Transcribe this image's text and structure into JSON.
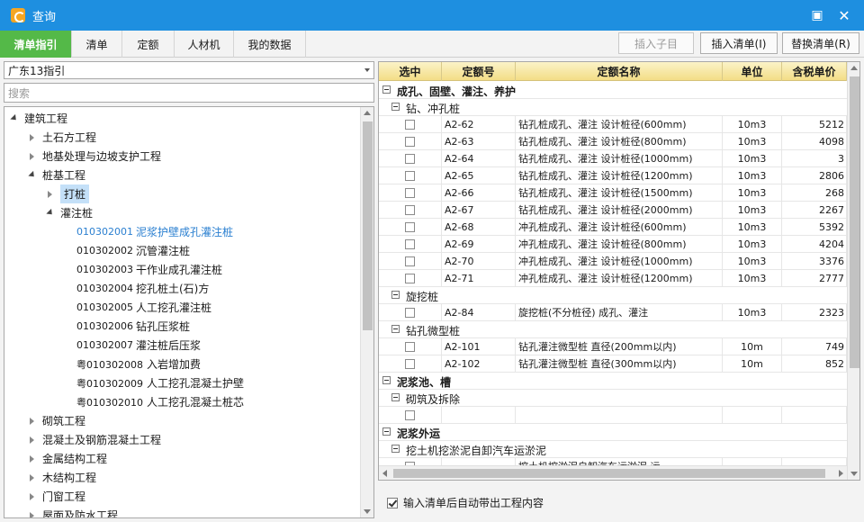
{
  "window": {
    "title": "查询"
  },
  "tabs": [
    {
      "label": "清单指引",
      "active": true
    },
    {
      "label": "清单"
    },
    {
      "label": "定额"
    },
    {
      "label": "人材机"
    },
    {
      "label": "我的数据"
    }
  ],
  "toolbar": {
    "insert_child": "插入子目",
    "insert_list": "插入清单(I)",
    "replace_list": "替换清单(R)"
  },
  "left": {
    "combo_value": "广东13指引",
    "search_placeholder": "搜索"
  },
  "tree": [
    {
      "label": "建筑工程",
      "level": 0,
      "state": "expanded"
    },
    {
      "label": "土石方工程",
      "level": 1,
      "state": "collapsed"
    },
    {
      "label": "地基处理与边坡支护工程",
      "level": 1,
      "state": "collapsed"
    },
    {
      "label": "桩基工程",
      "level": 1,
      "state": "expanded"
    },
    {
      "label": "打桩",
      "level": 2,
      "state": "collapsed",
      "selected": true
    },
    {
      "label": "灌注桩",
      "level": 2,
      "state": "expanded"
    },
    {
      "code": "010302001",
      "label": "泥浆护壁成孔灌注桩",
      "level": 3,
      "blue": true
    },
    {
      "code": "010302002",
      "label": "沉管灌注桩",
      "level": 3
    },
    {
      "code": "010302003",
      "label": "干作业成孔灌注桩",
      "level": 3
    },
    {
      "code": "010302004",
      "label": "挖孔桩土(石)方",
      "level": 3
    },
    {
      "code": "010302005",
      "label": "人工挖孔灌注桩",
      "level": 3
    },
    {
      "code": "010302006",
      "label": "钻孔压浆桩",
      "level": 3
    },
    {
      "code": "010302007",
      "label": "灌注桩后压浆",
      "level": 3
    },
    {
      "code": "粤010302008",
      "label": "入岩增加费",
      "level": 3,
      "wide": true
    },
    {
      "code": "粤010302009",
      "label": "人工挖孔混凝土护壁",
      "level": 3,
      "wide": true
    },
    {
      "code": "粤010302010",
      "label": "人工挖孔混凝土桩芯",
      "level": 3,
      "wide": true
    },
    {
      "label": "砌筑工程",
      "level": 1,
      "state": "collapsed"
    },
    {
      "label": "混凝土及钢筋混凝土工程",
      "level": 1,
      "state": "collapsed"
    },
    {
      "label": "金属结构工程",
      "level": 1,
      "state": "collapsed"
    },
    {
      "label": "木结构工程",
      "level": 1,
      "state": "collapsed"
    },
    {
      "label": "门窗工程",
      "level": 1,
      "state": "collapsed"
    },
    {
      "label": "屋面及防水工程",
      "level": 1,
      "state": "collapsed"
    }
  ],
  "grid": {
    "headers": [
      "选中",
      "定额号",
      "定额名称",
      "单位",
      "含税单价"
    ],
    "rows": [
      {
        "type": "g1",
        "label": "成孔、固壁、灌注、养护"
      },
      {
        "type": "g2",
        "label": "钻、冲孔桩"
      },
      {
        "type": "item",
        "code": "A2-62",
        "name": "钻孔桩成孔、灌注 设计桩径(600mm)",
        "unit": "10m3",
        "price": "5212"
      },
      {
        "type": "item",
        "code": "A2-63",
        "name": "钻孔桩成孔、灌注 设计桩径(800mm)",
        "unit": "10m3",
        "price": "4098"
      },
      {
        "type": "item",
        "code": "A2-64",
        "name": "钻孔桩成孔、灌注 设计桩径(1000mm)",
        "unit": "10m3",
        "price": "3"
      },
      {
        "type": "item",
        "code": "A2-65",
        "name": "钻孔桩成孔、灌注 设计桩径(1200mm)",
        "unit": "10m3",
        "price": "2806"
      },
      {
        "type": "item",
        "code": "A2-66",
        "name": "钻孔桩成孔、灌注 设计桩径(1500mm)",
        "unit": "10m3",
        "price": "268"
      },
      {
        "type": "item",
        "code": "A2-67",
        "name": "钻孔桩成孔、灌注 设计桩径(2000mm)",
        "unit": "10m3",
        "price": "2267"
      },
      {
        "type": "item",
        "code": "A2-68",
        "name": "冲孔桩成孔、灌注 设计桩径(600mm)",
        "unit": "10m3",
        "price": "5392"
      },
      {
        "type": "item",
        "code": "A2-69",
        "name": "冲孔桩成孔、灌注 设计桩径(800mm)",
        "unit": "10m3",
        "price": "4204"
      },
      {
        "type": "item",
        "code": "A2-70",
        "name": "冲孔桩成孔、灌注 设计桩径(1000mm)",
        "unit": "10m3",
        "price": "3376"
      },
      {
        "type": "item",
        "code": "A2-71",
        "name": "冲孔桩成孔、灌注 设计桩径(1200mm)",
        "unit": "10m3",
        "price": "2777"
      },
      {
        "type": "g2",
        "label": "旋挖桩"
      },
      {
        "type": "item",
        "code": "A2-84",
        "name": "旋挖桩(不分桩径) 成孔、灌注",
        "unit": "10m3",
        "price": "2323"
      },
      {
        "type": "g2",
        "label": "钻孔微型桩"
      },
      {
        "type": "item",
        "code": "A2-101",
        "name": "钻孔灌注微型桩 直径(200mm以内)",
        "unit": "10m",
        "price": "749"
      },
      {
        "type": "item",
        "code": "A2-102",
        "name": "钻孔灌注微型桩 直径(300mm以内)",
        "unit": "10m",
        "price": "852"
      },
      {
        "type": "g1",
        "label": "泥浆池、槽"
      },
      {
        "type": "g2",
        "label": "砌筑及拆除"
      },
      {
        "type": "item",
        "code": "",
        "name": "",
        "unit": "",
        "price": ""
      },
      {
        "type": "g1",
        "label": "泥浆外运"
      },
      {
        "type": "g2",
        "label": "挖土机挖淤泥自卸汽车运淤泥"
      },
      {
        "type": "item",
        "code": "",
        "name": "挖土机挖淤泥自卸汽车运淤泥 运",
        "unit": "",
        "price": ""
      }
    ]
  },
  "footer": {
    "auto_bring_label": "输入清单后自动带出工程内容"
  }
}
